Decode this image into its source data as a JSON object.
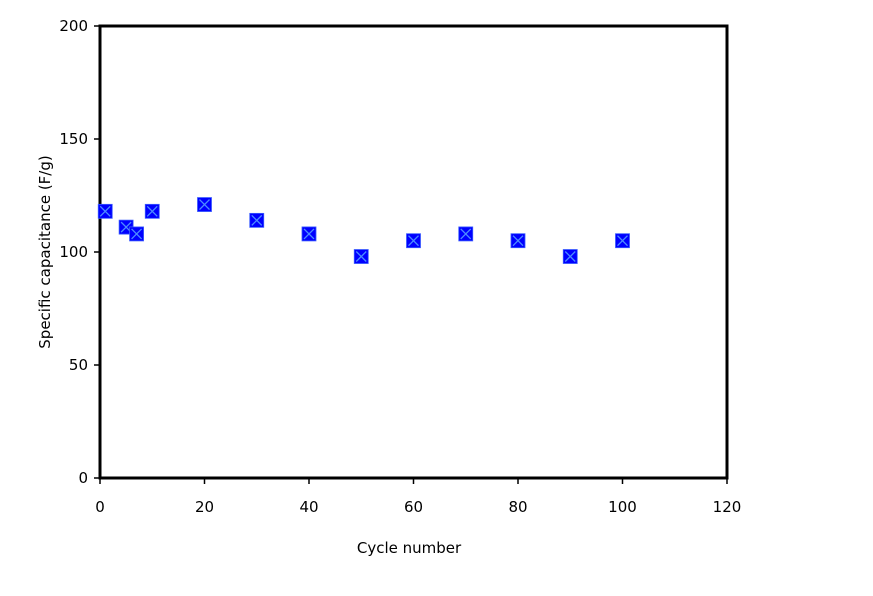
{
  "chart_data": {
    "type": "scatter",
    "title": "",
    "xlabel": "Cycle number",
    "ylabel": "Specific capacitance (F/g)",
    "xlim": [
      0,
      120
    ],
    "ylim": [
      0,
      200
    ],
    "xticks": [
      0,
      20,
      40,
      60,
      80,
      100,
      120
    ],
    "yticks": [
      0,
      50,
      100,
      150,
      200
    ],
    "xtick_labels": [
      "0",
      "20",
      "40",
      "60",
      "80",
      "100",
      "120"
    ],
    "ytick_labels": [
      "0",
      "50",
      "100",
      "150",
      "200"
    ],
    "grid": false,
    "legend": "none",
    "marker": "square-with-x",
    "marker_color": "#0000ff",
    "marker_cross_color": "#4d8cff",
    "series": [
      {
        "name": "Specific capacitance",
        "x": [
          1,
          5,
          7,
          10,
          20,
          30,
          40,
          50,
          60,
          70,
          80,
          90,
          100
        ],
        "y": [
          118,
          111,
          108,
          118,
          121,
          114,
          108,
          98,
          105,
          108,
          105,
          98,
          105
        ]
      }
    ]
  }
}
